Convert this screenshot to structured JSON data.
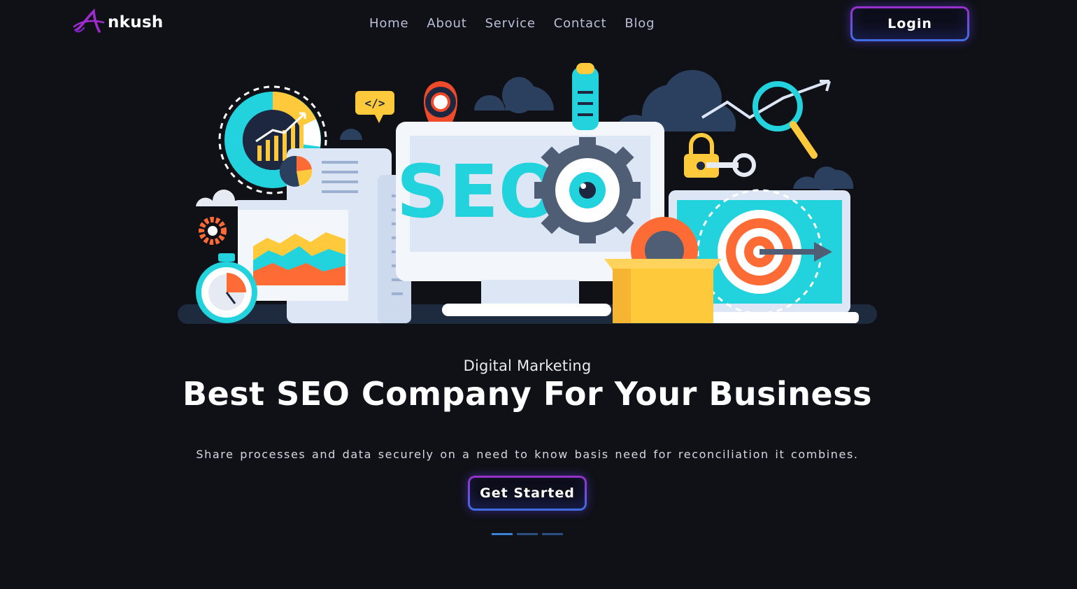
{
  "header": {
    "logo_text": "nkush",
    "nav": [
      "Home",
      "About",
      "Service",
      "Contact",
      "Blog"
    ],
    "login_label": "Login"
  },
  "hero": {
    "eyebrow": "Digital Marketing",
    "headline": "Best SEO Company For Your Business",
    "subtext": "Share processes and data securely on a need to know basis need for reconciliation it combines.",
    "cta_label": "Get Started",
    "illustration_text": "SEO",
    "illustration_code": "</>",
    "carousel_slides": 3,
    "carousel_active": 1
  },
  "colors": {
    "background": "#0f1117",
    "accent_purple": "#9b2fc9",
    "accent_blue": "#3f6fe3",
    "teal": "#22d3dd",
    "orange": "#ff6b35",
    "yellow": "#ffc93c"
  }
}
